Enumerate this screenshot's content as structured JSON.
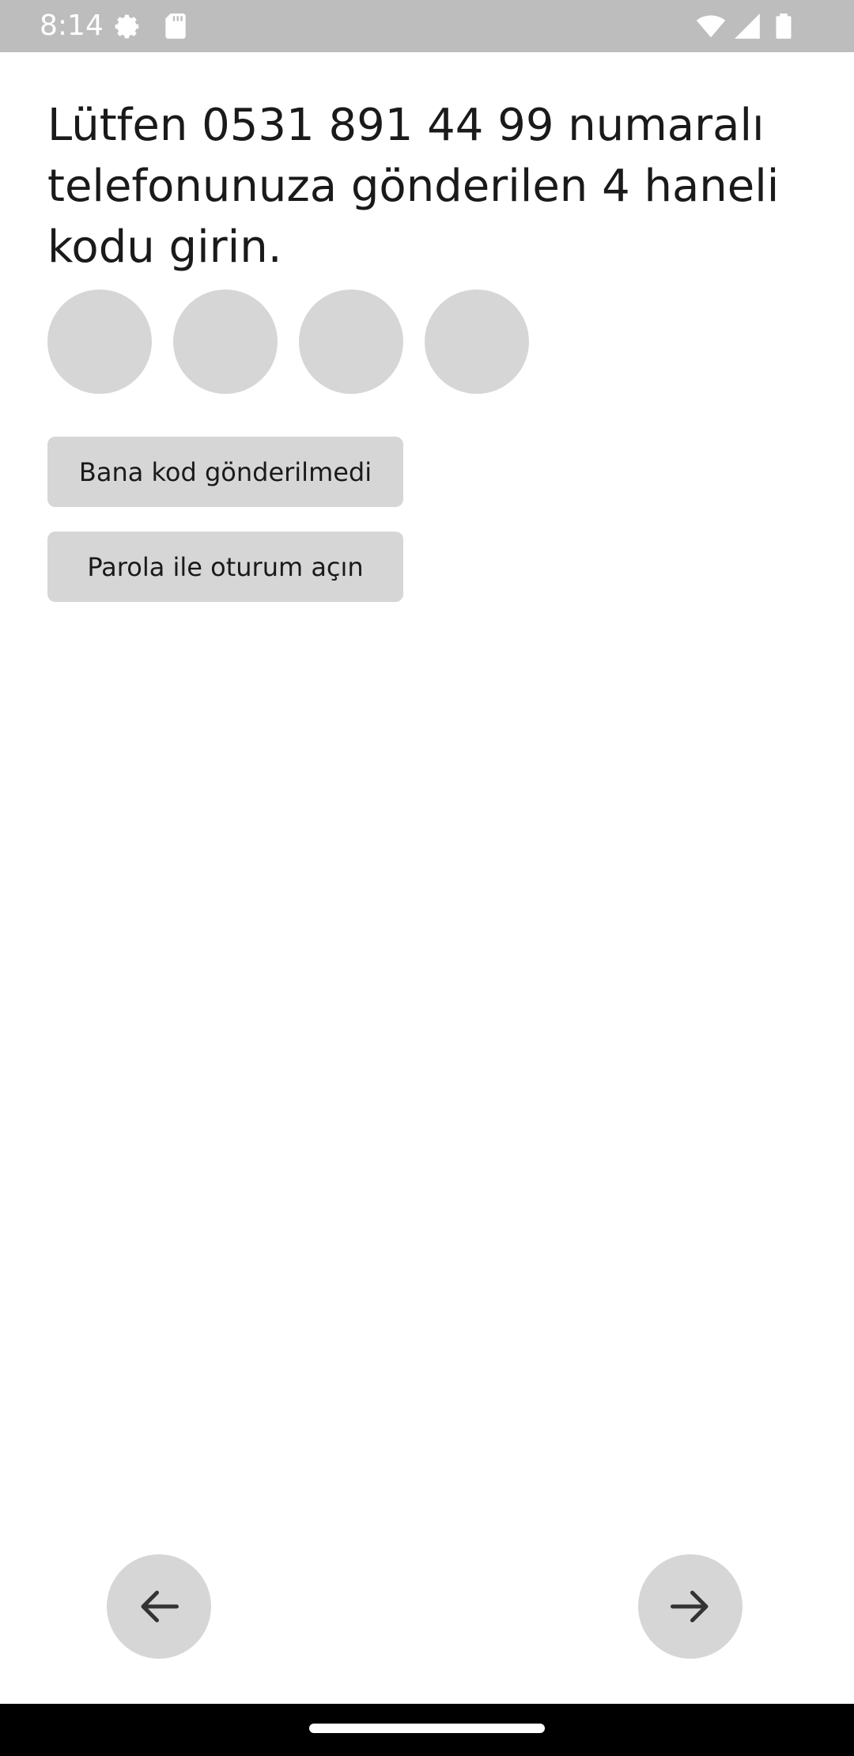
{
  "status_bar": {
    "time": "8:14",
    "icons": [
      "settings-gear-icon",
      "sd-card-icon",
      "wifi-icon",
      "cell-signal-icon",
      "battery-icon"
    ]
  },
  "prompt": {
    "text": "Lütfen 0531 891 44 99 numaralı telefonunuza gönderilen 4 haneli kodu girin."
  },
  "code_input": {
    "digits": [
      "",
      "",
      "",
      ""
    ]
  },
  "actions": {
    "no_code_label": "Bana kod gönderilmedi",
    "password_login_label": "Parola ile oturum açın"
  },
  "navigation": {
    "back_icon": "arrow-left-icon",
    "next_icon": "arrow-right-icon"
  },
  "colors": {
    "status_bar": "#bdbdbd",
    "control_fill": "#d6d6d6",
    "text": "#1a1a1a",
    "system_nav": "#000000"
  }
}
